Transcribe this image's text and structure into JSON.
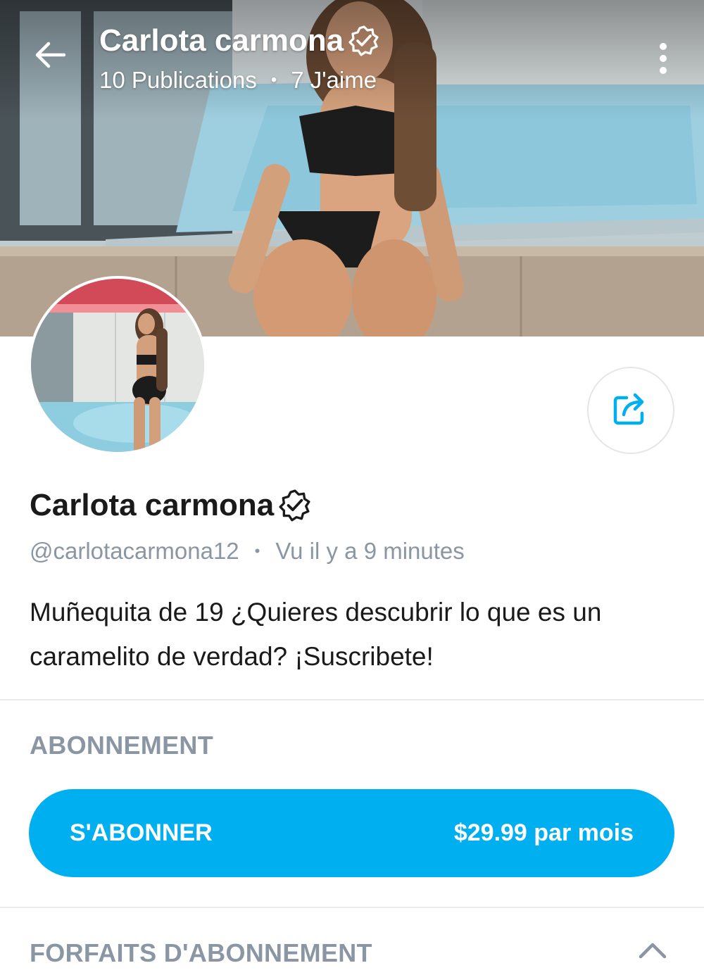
{
  "header": {
    "name": "Carlota carmona",
    "posts": "10 Publications",
    "separator": "•",
    "likes": "7 J'aime",
    "back_icon": "back-arrow-icon",
    "menu_icon": "more-vertical-icon",
    "verified_icon": "verified-badge-icon"
  },
  "profile": {
    "name": "Carlota carmona",
    "handle": "@carlotacarmona12",
    "separator": "•",
    "last_seen": "Vu il y a 9 minutes",
    "bio": "Muñequita de 19 ¿Quieres descubrir lo que es un caramelito de verdad? ¡Suscribete!",
    "share_icon": "share-icon",
    "verified_icon": "verified-badge-icon"
  },
  "subscription": {
    "title": "ABONNEMENT",
    "button_label": "S'ABONNER",
    "price": "$29.99 par mois"
  },
  "bundles": {
    "title": "FORFAITS D'ABONNEMENT",
    "toggle_icon": "chevron-up-icon"
  },
  "colors": {
    "accent": "#00aff0",
    "muted_text": "#8a96a3",
    "primary_text": "#1a1a1a"
  }
}
